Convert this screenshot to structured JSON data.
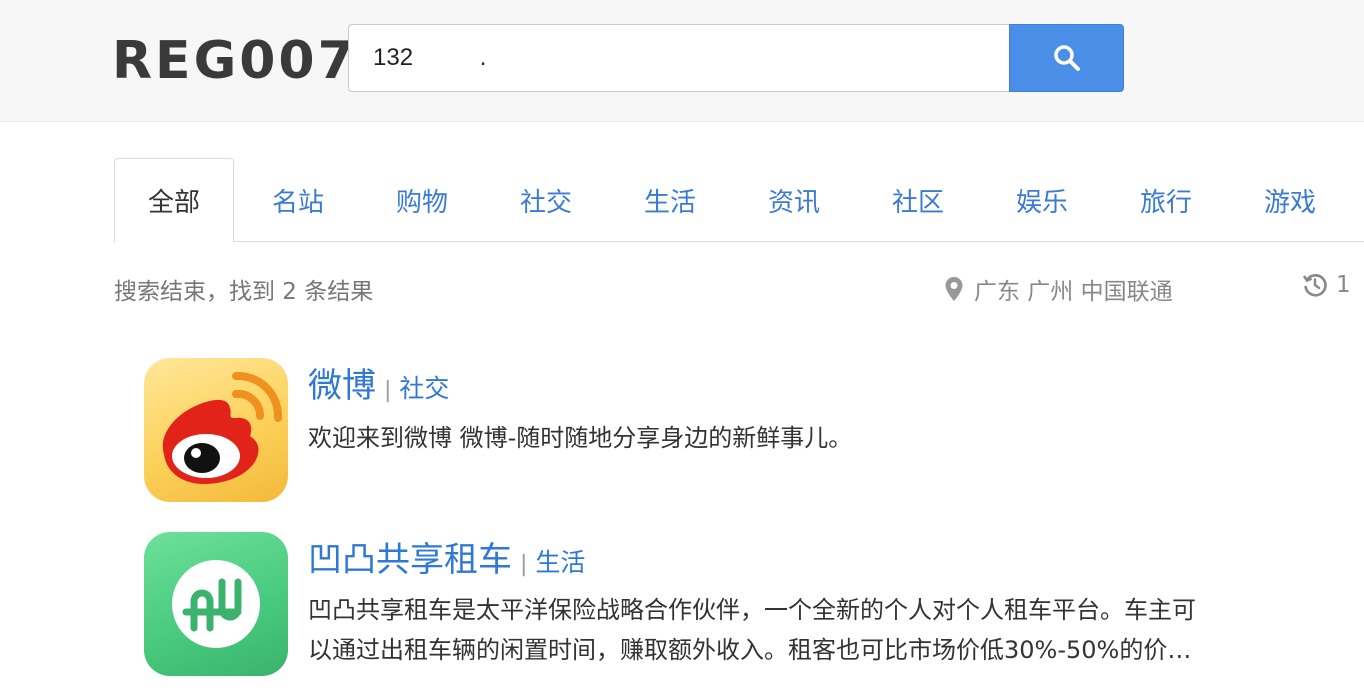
{
  "header": {
    "logo": "REG007",
    "search_value": "132          .",
    "search_placeholder": ""
  },
  "tabs": [
    {
      "label": "全部",
      "active": true
    },
    {
      "label": "名站",
      "active": false
    },
    {
      "label": "购物",
      "active": false
    },
    {
      "label": "社交",
      "active": false
    },
    {
      "label": "生活",
      "active": false
    },
    {
      "label": "资讯",
      "active": false
    },
    {
      "label": "社区",
      "active": false
    },
    {
      "label": "娱乐",
      "active": false
    },
    {
      "label": "旅行",
      "active": false
    },
    {
      "label": "游戏",
      "active": false
    }
  ],
  "status": {
    "text": "搜索结束，找到 2 条结果",
    "location": "广东 广州 中国联通",
    "history_count": "1"
  },
  "results": [
    {
      "title": "微博",
      "separator": "|",
      "category": "社交",
      "description": "欢迎来到微博 微博-随时随地分享身边的新鲜事儿。",
      "icon": "weibo-logo-icon"
    },
    {
      "title": "凹凸共享租车",
      "separator": "|",
      "category": "生活",
      "description_line1": "凹凸共享租车是太平洋保险战略合作伙伴，一个全新的个人对个人租车平台。车主可",
      "description_line2": "以通过出租车辆的闲置时间，赚取额外收入。租客也可比市场价低30%-50%的价…",
      "icon": "aotu-logo-icon"
    }
  ],
  "colors": {
    "accent": "#2f79d6",
    "search_button": "#4a8ee8",
    "header_bg": "#f7f7f7"
  }
}
